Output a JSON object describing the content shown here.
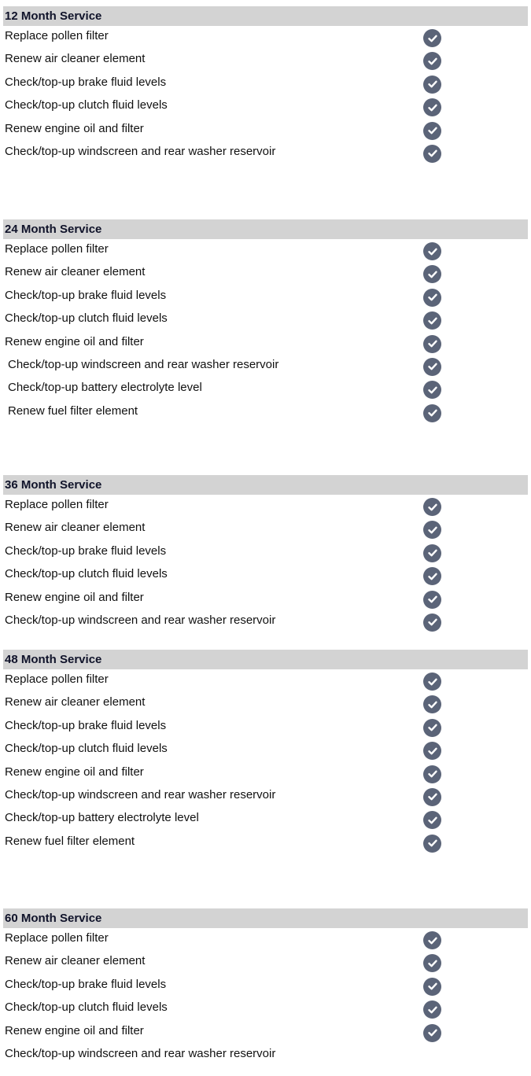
{
  "sections": [
    {
      "title": "12 Month Service",
      "items": [
        {
          "label": "Replace pollen filter",
          "done": true
        },
        {
          "label": "Renew air cleaner element",
          "done": true
        },
        {
          "label": "Check/top-up brake fluid levels",
          "done": true
        },
        {
          "label": "Check/top-up clutch fluid levels",
          "done": true
        },
        {
          "label": "Renew engine oil and filter",
          "done": true
        },
        {
          "label": "Check/top-up windscreen and rear washer reservoir",
          "done": true
        }
      ]
    },
    {
      "title": "24 Month Service",
      "items": [
        {
          "label": "Replace pollen filter",
          "done": true
        },
        {
          "label": "Renew air cleaner element",
          "done": true
        },
        {
          "label": "Check/top-up brake fluid levels",
          "done": true
        },
        {
          "label": "Check/top-up clutch fluid levels",
          "done": true
        },
        {
          "label": "Renew engine oil and filter",
          "done": true
        },
        {
          "label": "Check/top-up windscreen and rear washer reservoir",
          "done": true
        },
        {
          "label": "Check/top-up battery electrolyte level",
          "done": true
        },
        {
          "label": "Renew fuel filter element",
          "done": true
        }
      ]
    },
    {
      "title": "36 Month Service",
      "items": [
        {
          "label": "Replace pollen filter",
          "done": true
        },
        {
          "label": "Renew air cleaner element",
          "done": true
        },
        {
          "label": "Check/top-up brake fluid levels",
          "done": true
        },
        {
          "label": "Check/top-up clutch fluid levels",
          "done": true
        },
        {
          "label": "Renew engine oil and filter",
          "done": true
        },
        {
          "label": "Check/top-up windscreen and rear washer reservoir",
          "done": true
        }
      ]
    },
    {
      "title": "48 Month Service",
      "items": [
        {
          "label": "Replace pollen filter",
          "done": true
        },
        {
          "label": "Renew air cleaner element",
          "done": true
        },
        {
          "label": "Check/top-up brake fluid levels",
          "done": true
        },
        {
          "label": "Check/top-up clutch fluid levels",
          "done": true
        },
        {
          "label": "Renew engine oil and filter",
          "done": true
        },
        {
          "label": "Check/top-up windscreen and rear washer reservoir",
          "done": true
        },
        {
          "label": "Check/top-up battery electrolyte level",
          "done": true
        },
        {
          "label": "Renew fuel filter element",
          "done": true
        }
      ]
    },
    {
      "title": "60 Month Service",
      "items": [
        {
          "label": "Replace pollen filter",
          "done": true
        },
        {
          "label": "Renew air cleaner element",
          "done": true
        },
        {
          "label": "Check/top-up brake fluid levels",
          "done": true
        },
        {
          "label": "Check/top-up clutch fluid levels",
          "done": true
        },
        {
          "label": "Renew engine oil and filter",
          "done": true
        },
        {
          "label": "Check/top-up windscreen and rear washer reservoir",
          "done": false
        }
      ]
    }
  ],
  "icons": {
    "check": "check-circle-icon"
  },
  "colors": {
    "header_bg": "#d3d3d3",
    "check_bg": "#5b6478"
  }
}
